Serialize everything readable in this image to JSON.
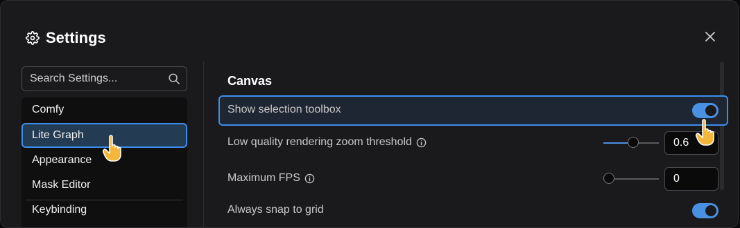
{
  "dialog": {
    "title": "Settings",
    "icons": {
      "title": "gear-icon",
      "close": "close-icon"
    }
  },
  "sidebar": {
    "search": {
      "placeholder": "Search Settings...",
      "value": "",
      "icon": "search-icon"
    },
    "items": [
      {
        "label": "Comfy",
        "active": false
      },
      {
        "label": "Lite Graph",
        "active": true
      },
      {
        "label": "Appearance",
        "active": false
      },
      {
        "label": "Mask Editor",
        "active": false
      },
      {
        "label": "Keybinding",
        "active": false
      }
    ]
  },
  "main": {
    "section_title": "Canvas",
    "settings": [
      {
        "label": "Show selection toolbox",
        "control": "toggle",
        "value": true,
        "highlighted": true
      },
      {
        "label": "Low quality rendering zoom threshold",
        "control": "slider-number",
        "value": "0.6",
        "slider_fraction": 0.55,
        "info_icon": true
      },
      {
        "label": "Maximum FPS",
        "control": "slider-number",
        "value": "0",
        "slider_fraction": 0.0,
        "info_icon": true
      },
      {
        "label": "Always snap to grid",
        "control": "toggle",
        "value": true
      }
    ]
  },
  "colors": {
    "accent": "#3d8eec",
    "toggle_on": "#4a90e2",
    "background": "#1a1a1c",
    "active_item_bg": "#243b54"
  }
}
